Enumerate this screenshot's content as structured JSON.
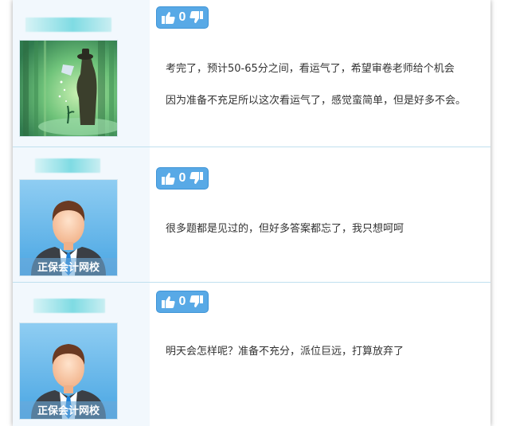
{
  "posts": [
    {
      "avatar": "forest-watering-illustration",
      "likes": "0",
      "lines": [
        "考完了，预计50-65分之间，看运气了，希望审卷老师给个机会",
        "因为准备不充足所以这次看运气了，感觉蛮简单，但是好多不会。"
      ]
    },
    {
      "avatar": "default-avatar",
      "avatar_caption": "正保会计网校",
      "likes": "0",
      "lines": [
        "很多题都是见过的，但好多答案都忘了，我只想呵呵"
      ]
    },
    {
      "avatar": "default-avatar",
      "avatar_caption": "正保会计网校",
      "likes": "0",
      "lines": [
        "明天会怎样呢？准备不充分，派位巨远，打算放弃了"
      ]
    }
  ],
  "icons": {
    "like": "thumbs-up-icon",
    "dislike": "thumbs-down-icon"
  },
  "colors": {
    "vote_bg": "#58a9e6",
    "left_column": "#f2f8fd",
    "divider": "#bfe0ef"
  }
}
